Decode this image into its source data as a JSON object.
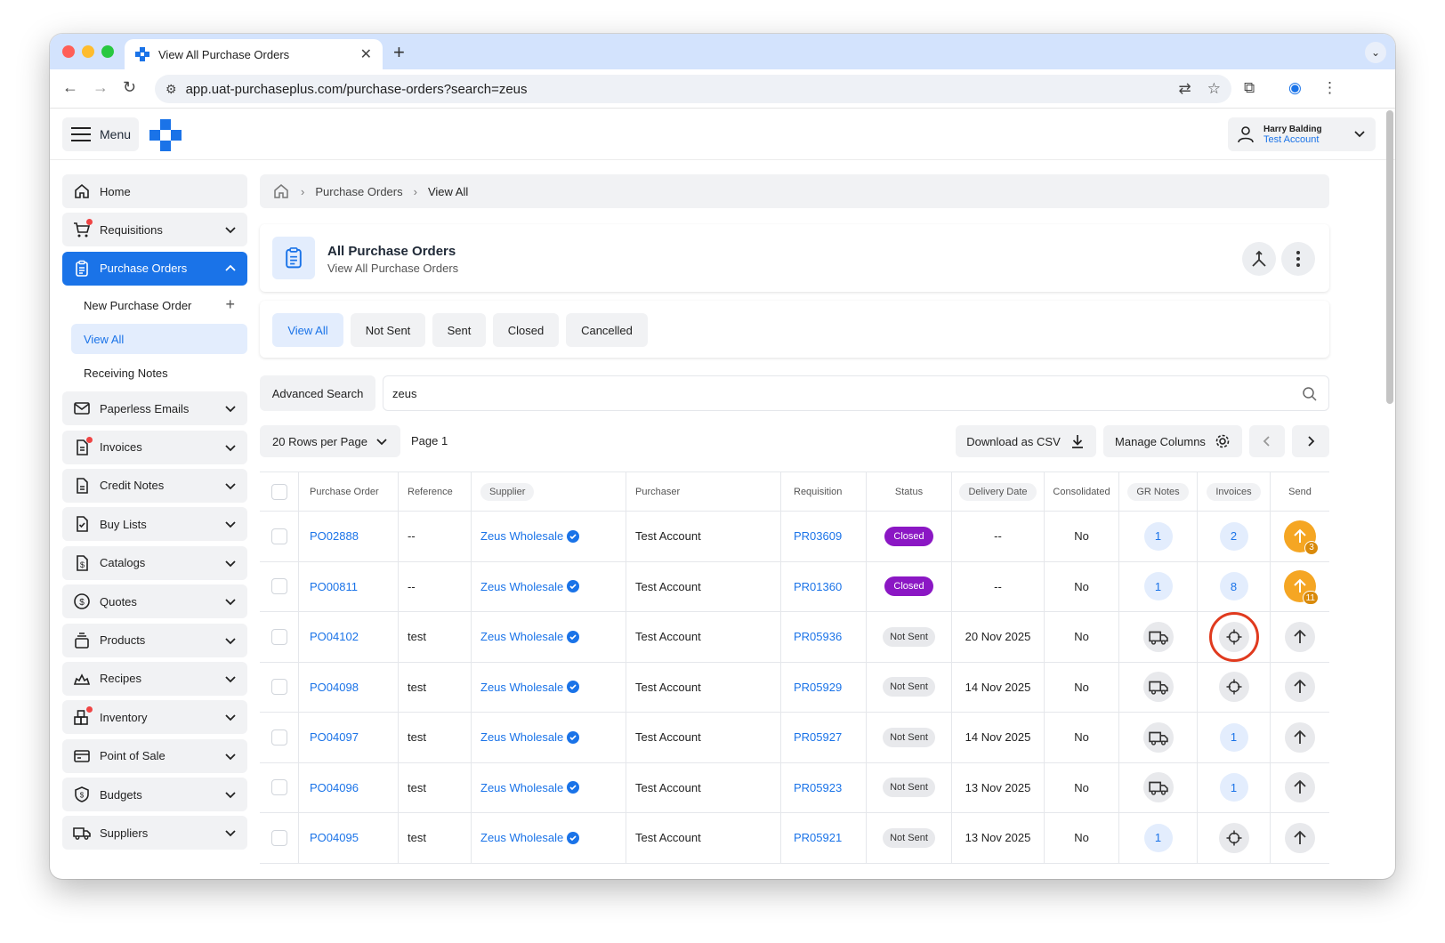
{
  "browser": {
    "tab_title": "View All Purchase Orders",
    "url": "app.uat-purchaseplus.com/purchase-orders?search=zeus"
  },
  "header": {
    "menu_label": "Menu",
    "user_name": "Harry Balding",
    "user_account": "Test Account"
  },
  "sidebar": {
    "items": [
      {
        "label": "Home"
      },
      {
        "label": "Requisitions"
      },
      {
        "label": "Purchase Orders"
      },
      {
        "label": "Paperless Emails"
      },
      {
        "label": "Invoices"
      },
      {
        "label": "Credit Notes"
      },
      {
        "label": "Buy Lists"
      },
      {
        "label": "Catalogs"
      },
      {
        "label": "Quotes"
      },
      {
        "label": "Products"
      },
      {
        "label": "Recipes"
      },
      {
        "label": "Inventory"
      },
      {
        "label": "Point of Sale"
      },
      {
        "label": "Budgets"
      },
      {
        "label": "Suppliers"
      }
    ],
    "sub_items": [
      {
        "label": "New Purchase Order"
      },
      {
        "label": "View All"
      },
      {
        "label": "Receiving Notes"
      }
    ]
  },
  "breadcrumb": {
    "items": [
      "Purchase Orders",
      "View All"
    ]
  },
  "page": {
    "title": "All Purchase Orders",
    "subtitle": "View All Purchase Orders"
  },
  "filters": {
    "tabs": [
      "View All",
      "Not Sent",
      "Sent",
      "Closed",
      "Cancelled"
    ]
  },
  "search": {
    "advanced_label": "Advanced Search",
    "value": "zeus"
  },
  "toolbar": {
    "rows_per_page": "20 Rows per Page",
    "page_label": "Page 1",
    "download_label": "Download as CSV",
    "manage_columns_label": "Manage Columns"
  },
  "table": {
    "columns": [
      "Purchase Order",
      "Reference",
      "Supplier",
      "Purchaser",
      "Requisition",
      "Status",
      "Delivery Date",
      "Consolidated",
      "GR Notes",
      "Invoices",
      "Send"
    ],
    "rows": [
      {
        "po": "PO02888",
        "reference": "--",
        "supplier": "Zeus Wholesale",
        "purchaser": "Test Account",
        "requisition": "PR03609",
        "status": "Closed",
        "delivery_date": "--",
        "consolidated": "No",
        "gr_notes": "1",
        "invoices": "2",
        "send_count": "3"
      },
      {
        "po": "PO00811",
        "reference": "--",
        "supplier": "Zeus Wholesale",
        "purchaser": "Test Account",
        "requisition": "PR01360",
        "status": "Closed",
        "delivery_date": "--",
        "consolidated": "No",
        "gr_notes": "1",
        "invoices": "8",
        "send_count": "11"
      },
      {
        "po": "PO04102",
        "reference": "test",
        "supplier": "Zeus Wholesale",
        "purchaser": "Test Account",
        "requisition": "PR05936",
        "status": "Not Sent",
        "delivery_date": "20 Nov 2025",
        "consolidated": "No"
      },
      {
        "po": "PO04098",
        "reference": "test",
        "supplier": "Zeus Wholesale",
        "purchaser": "Test Account",
        "requisition": "PR05929",
        "status": "Not Sent",
        "delivery_date": "14 Nov 2025",
        "consolidated": "No"
      },
      {
        "po": "PO04097",
        "reference": "test",
        "supplier": "Zeus Wholesale",
        "purchaser": "Test Account",
        "requisition": "PR05927",
        "status": "Not Sent",
        "delivery_date": "14 Nov 2025",
        "consolidated": "No",
        "invoices": "1"
      },
      {
        "po": "PO04096",
        "reference": "test",
        "supplier": "Zeus Wholesale",
        "purchaser": "Test Account",
        "requisition": "PR05923",
        "status": "Not Sent",
        "delivery_date": "13 Nov 2025",
        "consolidated": "No",
        "invoices": "1"
      },
      {
        "po": "PO04095",
        "reference": "test",
        "supplier": "Zeus Wholesale",
        "purchaser": "Test Account",
        "requisition": "PR05921",
        "status": "Not Sent",
        "delivery_date": "13 Nov 2025",
        "consolidated": "No",
        "gr_notes": "1"
      }
    ]
  },
  "colors": {
    "accent": "#1a73e8",
    "closed_badge": "#8b17c4",
    "send_orange": "#f5a623",
    "highlight": "#e03a1e"
  }
}
